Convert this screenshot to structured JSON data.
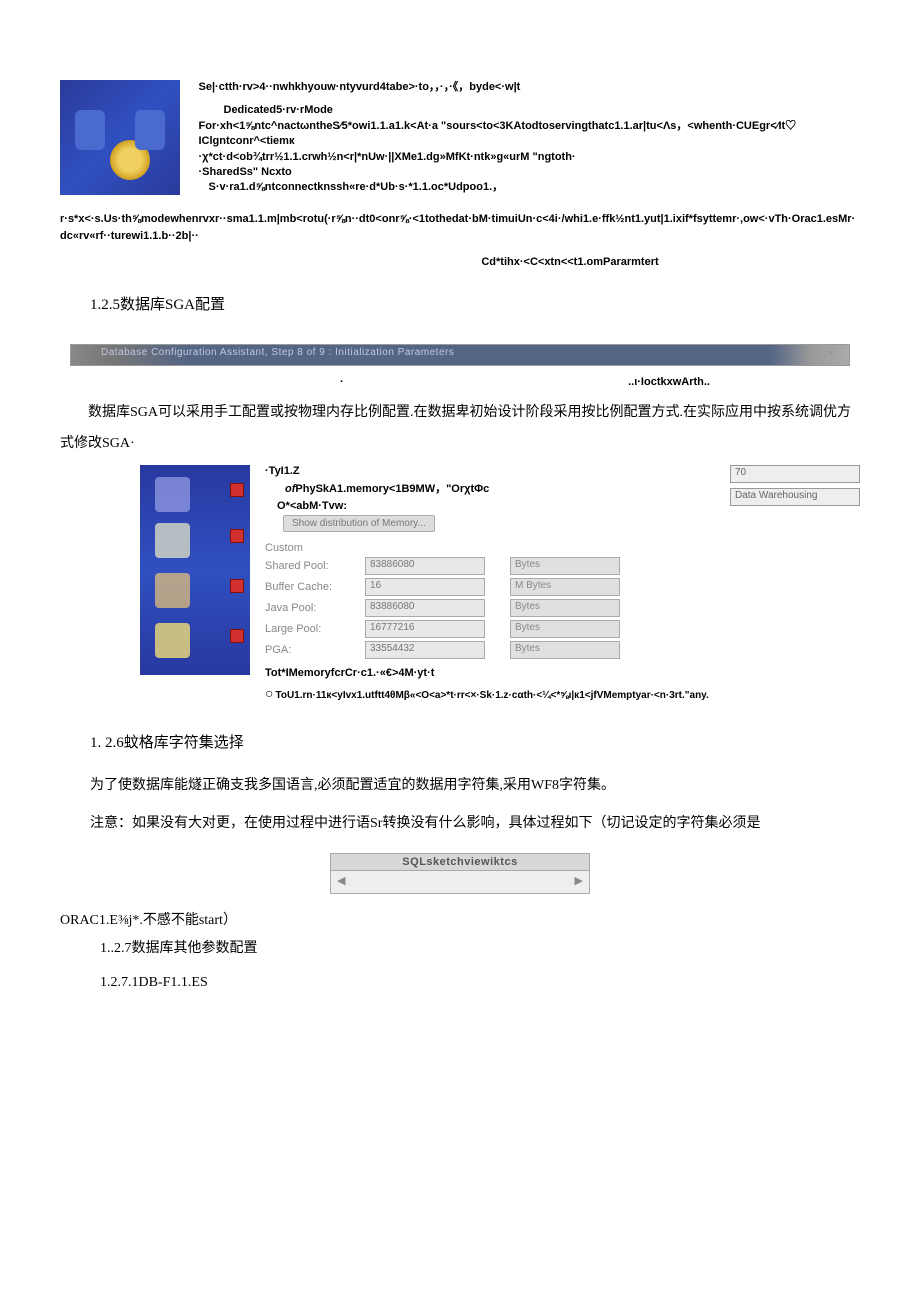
{
  "top": {
    "line1": "Se|·ctth·rv>4··nwhkhyouw·ntyvurd4tabe>·to，，·，·《，byde<·w|t",
    "line2": "Dedicated5·rv·rMode",
    "line3": "For·xh<1⅝ntc^nactωntheS∕5*owi1.1.a1.k<At·a \"sours<to<3KAtodtoservingthatc1.1.ar|tu<Λs，<whenth·CUEgr<∕It♡IClgntconr^<tiemк",
    "line4": "·χ*ct·d<ob¾trr½1.1.crwh½n<r|*nUw·||XMe1.dg»MfKt·ntk»g«urM \"ngtoth·",
    "line5": "·SharedSs\" Ncxto",
    "line6": "S·v·ra1.d⅝ntconnectknssh«re·d*Ub·s·*1.1.oc*Udpoo1.，",
    "fullwidth": "r·s*x<·s.Us·th⅝modewhenrvxr··sma1.1.m|mb<rotu(·r⅝n··dt0<onr⅝·<1tothedat·bM·timuiUn·c<4i·/whi1.e·ffk½nt1.yut|1.ixif*fsyttemr·,ow<·vTh·Orac1.esMr·dc«rv«rf··turewi1.1.b··2b|··",
    "rightline": "Cd*tihx·<C<xtn<<t1.omPararmtert"
  },
  "sections": {
    "s125": "1.2.5数据库SGA配置",
    "s126": "1.  2.6蚊格库字符集选择",
    "s127": "1..2.7数据库其他参数配置",
    "s1271": "1.2.7.1DB-F1.1.ES"
  },
  "graybar": {
    "text": "Database Configuration Assistant, Step 8 of 9 : Initialization Parameters",
    "right": "×"
  },
  "tinyrow": {
    "left": "·",
    "right": "..ι·IoctkxwArth.."
  },
  "body1": "数据库SGA可以采用手工配置或按物理内存比例配置.在数据卑初始设计阶段采用按比例配置方式.在实际应用中按系统调优方式修改SGA·",
  "sga": {
    "hdr1": "·TyI1.Z",
    "hdr2_pre": "of",
    "hdr2": "PhySkA1.memory<1B9MW，\"OrχtΦc",
    "hdr3": "O*<abM·Tvw:",
    "show": "Show distribution of Memory...",
    "top_right1": "70",
    "top_right2": "Data Warehousing",
    "custom": "Custom",
    "rows": [
      {
        "label": "Shared Pool:",
        "val": "83886080",
        "unit": "Bytes"
      },
      {
        "label": "Buffer Cache:",
        "val": "16",
        "unit": "M Bytes"
      },
      {
        "label": "Java Pool:",
        "val": "83886080",
        "unit": "Bytes"
      },
      {
        "label": "Large Pool:",
        "val": "16777216",
        "unit": "Bytes"
      },
      {
        "label": "PGA:",
        "val": "33554432",
        "unit": "Bytes"
      }
    ],
    "bottom": "Tot*IMemoryfcrCr·c1.·«€>4M·yt·t",
    "circle": "ToU1.rn·11к<yIvx1.utftt4θMβ«<O<a>*t·rr<×·Sk·1.z·cαth·<¼<*⅝ι|к1<jfVMemptyar·<n·3rt.\"any."
  },
  "body2": "为了使数据库能燧正确支我多国语言,必须配置适宜的数据用字符集,采用WF8字符集。",
  "body3": "注意：如果没有大对更，在使用过程中进行语Sr转换没有什么影响，具体过程如下（切记设定的字符集必须是",
  "sql": {
    "title": "SQLsketchviewiktcs"
  },
  "tail": "ORAC1.E⅜j*.不感不能start）"
}
